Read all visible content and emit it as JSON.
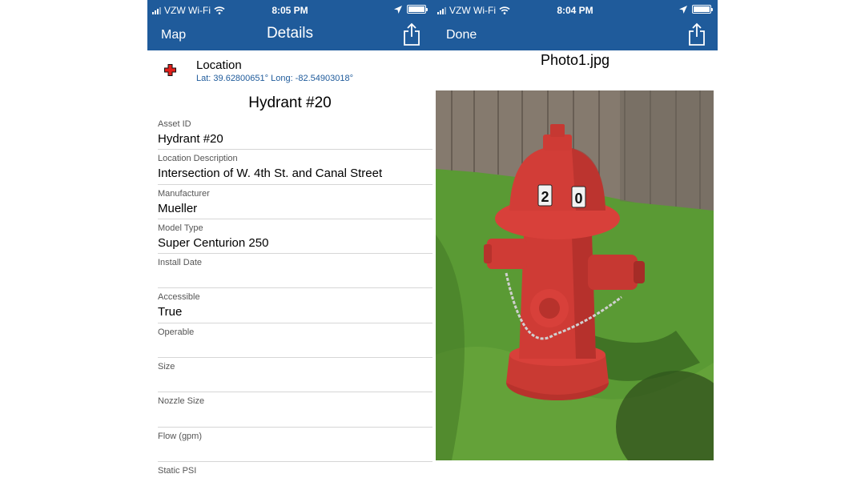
{
  "colors": {
    "navbar": "#1f5b9b",
    "link": "#1f5b9b",
    "hydrant_red": "#d8403a",
    "grass": "#4f8f2e",
    "fence": "#8a7e72"
  },
  "details_screen": {
    "status": {
      "carrier": "VZW Wi-Fi",
      "time": "8:05 PM"
    },
    "nav": {
      "back_label": "Map",
      "title": "Details",
      "share_icon": "share-icon"
    },
    "location": {
      "title": "Location",
      "coords": "Lat: 39.62800651° Long: -82.54903018°",
      "icon": "hydrant-marker-icon"
    },
    "asset_title": "Hydrant #20",
    "fields": [
      {
        "label": "Asset ID",
        "value": "Hydrant #20"
      },
      {
        "label": "Location Description",
        "value": "Intersection of W. 4th St. and Canal Street"
      },
      {
        "label": "Manufacturer",
        "value": "Mueller"
      },
      {
        "label": "Model Type",
        "value": "Super Centurion 250"
      },
      {
        "label": "Install Date",
        "value": ""
      },
      {
        "label": "Accessible",
        "value": "True"
      },
      {
        "label": "Operable",
        "value": ""
      },
      {
        "label": "Size",
        "value": ""
      },
      {
        "label": "Nozzle Size",
        "value": ""
      },
      {
        "label": "Flow (gpm)",
        "value": ""
      },
      {
        "label": "Static PSI",
        "value": ""
      }
    ]
  },
  "photo_screen": {
    "status": {
      "carrier": "VZW Wi-Fi",
      "time": "8:04 PM"
    },
    "nav": {
      "done_label": "Done",
      "share_icon": "share-icon"
    },
    "photo_title": "Photo1.jpg",
    "photo_number": "20"
  }
}
